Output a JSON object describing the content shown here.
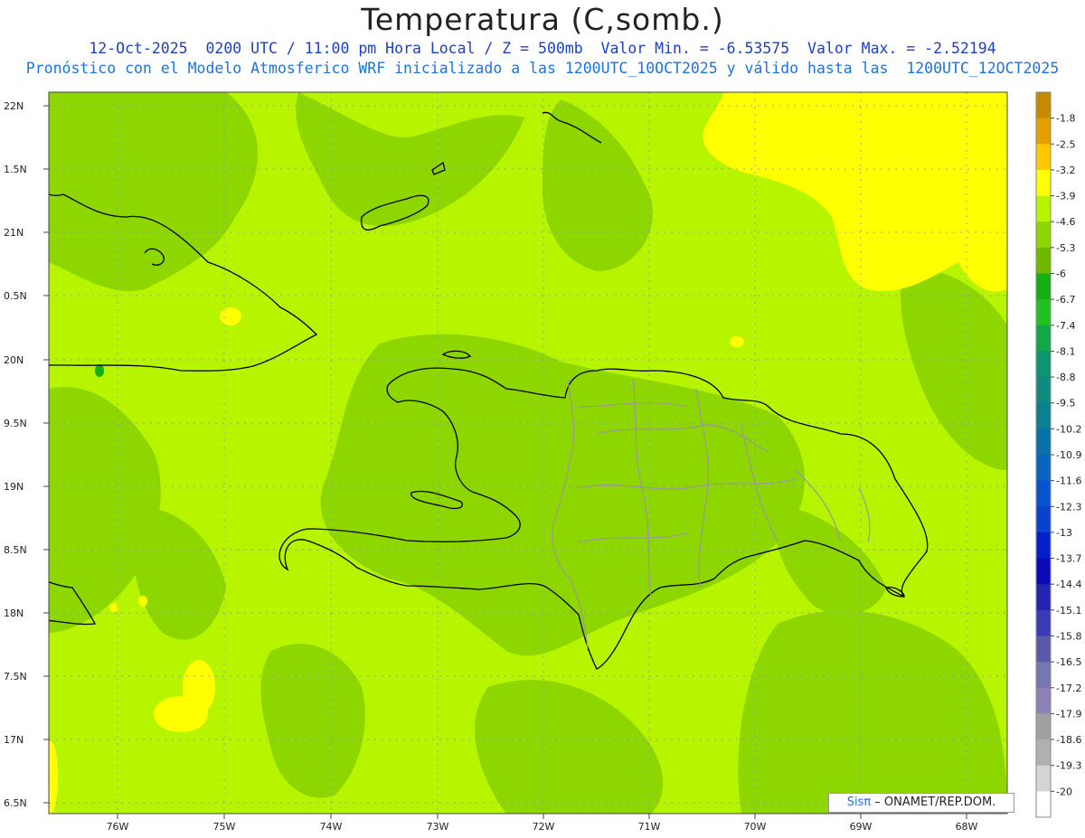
{
  "title": "Temperatura (C,somb.)",
  "subtitle_line1": "12-Oct-2025  0200 UTC / 11:00 pm Hora Local / Z = 500mb  Valor Min. = -6.53575  Valor Max. = -2.52194",
  "subtitle_line2": "Pronóstico con el Modelo Atmosferico WRF inicializado a las 1200UTC_10OCT2025 y válido hasta las  1200UTC_12OCT2025",
  "credit": {
    "brand": "Sisπ",
    "text": " – ONAMET/REP.DOM."
  },
  "axes": {
    "lat_labels": [
      "22N",
      "1.5N",
      "21N",
      "0.5N",
      "20N",
      "9.5N",
      "19N",
      "8.5N",
      "18N",
      "7.5N",
      "17N",
      "6.5N"
    ],
    "lon_labels": [
      "76W",
      "75W",
      "74W",
      "73W",
      "72W",
      "71W",
      "70W",
      "69W",
      "68W"
    ]
  },
  "colorbar": {
    "labels": [
      "-1.8",
      "-2.5",
      "-3.2",
      "-3.9",
      "-4.6",
      "-5.3",
      "-6",
      "-6.7",
      "-7.4",
      "-8.1",
      "-8.8",
      "-9.5",
      "-10.2",
      "-10.9",
      "-11.6",
      "-12.3",
      "-13",
      "-13.7",
      "-14.4",
      "-15.1",
      "-15.8",
      "-16.5",
      "-17.2",
      "-17.9",
      "-18.6",
      "-19.3",
      "-20"
    ],
    "colors": [
      "#c48a00",
      "#e3a000",
      "#ffc800",
      "#ffff00",
      "#b7f400",
      "#8ed600",
      "#6eb800",
      "#12b012",
      "#22c21e",
      "#12a848",
      "#0e9470",
      "#0e8c80",
      "#0a8090",
      "#0872a8",
      "#0866c2",
      "#0854d0",
      "#0a42d0",
      "#0620c8",
      "#0a0ab8",
      "#2424b0",
      "#3a3ab8",
      "#5a5aac",
      "#7676b0",
      "#8c80b4",
      "#a0a0a0",
      "#b0b0b0",
      "#d4d4d4",
      "#ffffff"
    ]
  },
  "colors": {
    "title": "#222222",
    "subtitle1": "#1a3fcc",
    "subtitle2": "#1a73e8",
    "field_base": "#b7f400",
    "field_mid": "#8ed600",
    "field_warm": "#ffff00",
    "grid": "#8888ff",
    "coast": "#000000",
    "provinces": "#999999"
  }
}
